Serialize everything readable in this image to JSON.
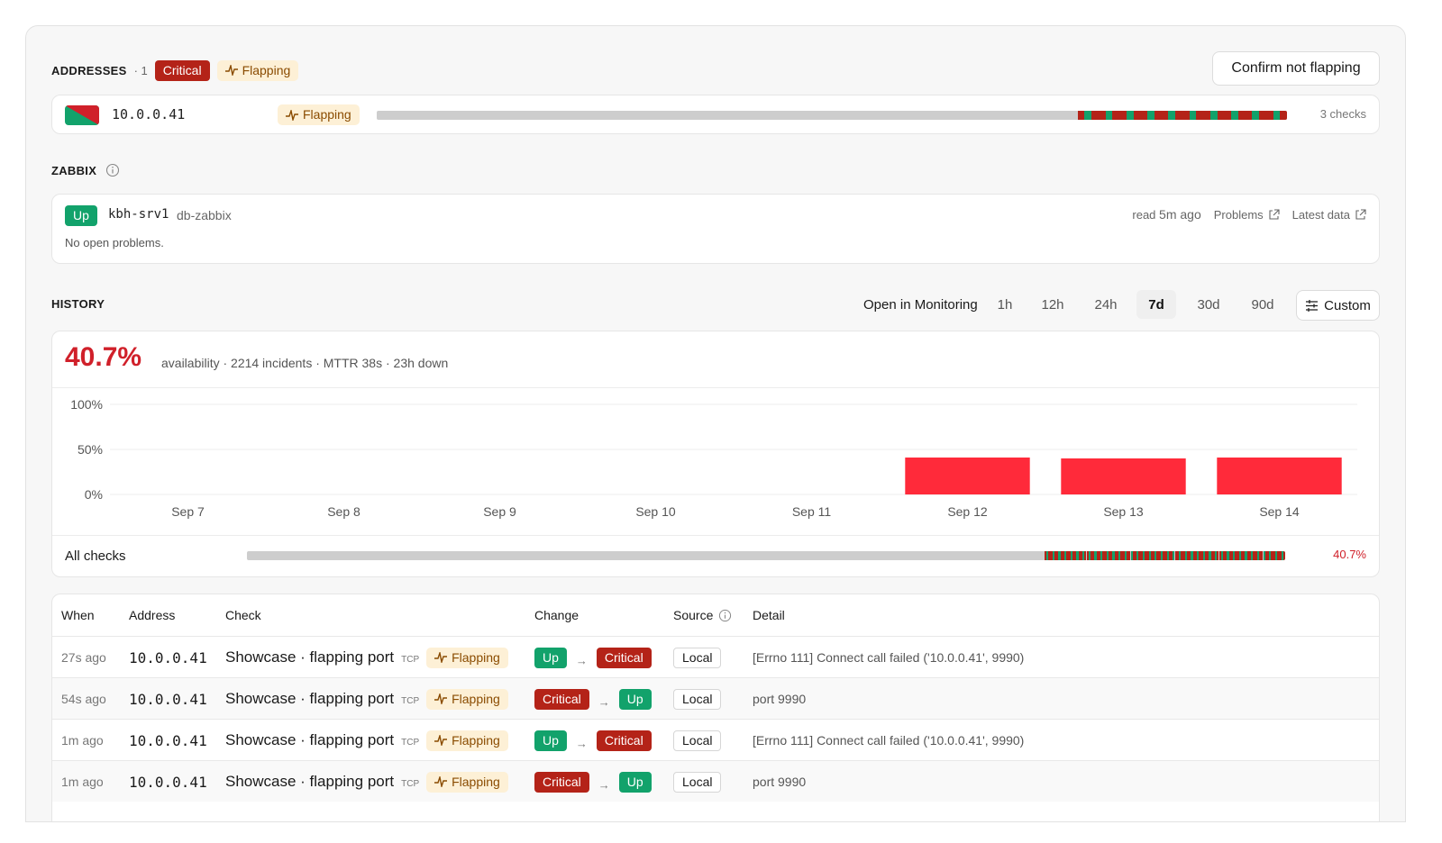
{
  "addresses": {
    "title": "ADDRESSES",
    "count": "· 1",
    "status_badge": "Critical",
    "flapping_badge": "Flapping",
    "confirm_button": "Confirm not flapping",
    "rows": [
      {
        "ip": "10.0.0.41",
        "flapping": "Flapping",
        "checks": "3 checks"
      }
    ]
  },
  "zabbix": {
    "title": "ZABBIX",
    "status": "Up",
    "host": "kbh-srv1",
    "instance": "db-zabbix",
    "read_label": "read",
    "read_time": "5m ago",
    "problems_link": "Problems",
    "latest_link": "Latest data",
    "no_problems": "No open problems."
  },
  "history": {
    "title": "HISTORY",
    "open_monitoring": "Open in Monitoring",
    "ranges": [
      "1h",
      "12h",
      "24h",
      "7d",
      "30d",
      "90d"
    ],
    "active_range": "7d",
    "custom_label": "Custom",
    "availability": "40.7%",
    "summary": "availability · 2214 incidents · MTTR 38s · 23h down",
    "all_checks_label": "All checks",
    "all_checks_value": "40.7%"
  },
  "chart_data": {
    "type": "bar",
    "categories": [
      "Sep 7",
      "Sep 8",
      "Sep 9",
      "Sep 10",
      "Sep 11",
      "Sep 12",
      "Sep 13",
      "Sep 14"
    ],
    "values": [
      0,
      0,
      0,
      0,
      0,
      41,
      40,
      41
    ],
    "ylim": [
      0,
      100
    ],
    "yticks": [
      "100%",
      "50%",
      "0%"
    ],
    "bar_color": "#ff2a3a",
    "grid": true,
    "title": "",
    "xlabel": "",
    "ylabel": ""
  },
  "table": {
    "headers": [
      "When",
      "Address",
      "Check",
      "Change",
      "Source",
      "Detail"
    ],
    "rows": [
      {
        "when": "27s ago",
        "address": "10.0.0.41",
        "check": "Showcase · flapping port",
        "proto": "TCP",
        "flap": "Flapping",
        "from": "Up",
        "to": "Critical",
        "source": "Local",
        "detail": "[Errno 111] Connect call failed ('10.0.0.41', 9990)"
      },
      {
        "when": "54s ago",
        "address": "10.0.0.41",
        "check": "Showcase · flapping port",
        "proto": "TCP",
        "flap": "Flapping",
        "from": "Critical",
        "to": "Up",
        "source": "Local",
        "detail": "port 9990"
      },
      {
        "when": "1m ago",
        "address": "10.0.0.41",
        "check": "Showcase · flapping port",
        "proto": "TCP",
        "flap": "Flapping",
        "from": "Up",
        "to": "Critical",
        "source": "Local",
        "detail": "[Errno 111] Connect call failed ('10.0.0.41', 9990)"
      },
      {
        "when": "1m ago",
        "address": "10.0.0.41",
        "check": "Showcase · flapping port",
        "proto": "TCP",
        "flap": "Flapping",
        "from": "Critical",
        "to": "Up",
        "source": "Local",
        "detail": "port 9990"
      }
    ],
    "arrow": "→"
  },
  "colors": {
    "critical": "#b42318",
    "up": "#12a26b",
    "flap_bg": "#fdf0d6",
    "bar": "#ff2a3a"
  }
}
